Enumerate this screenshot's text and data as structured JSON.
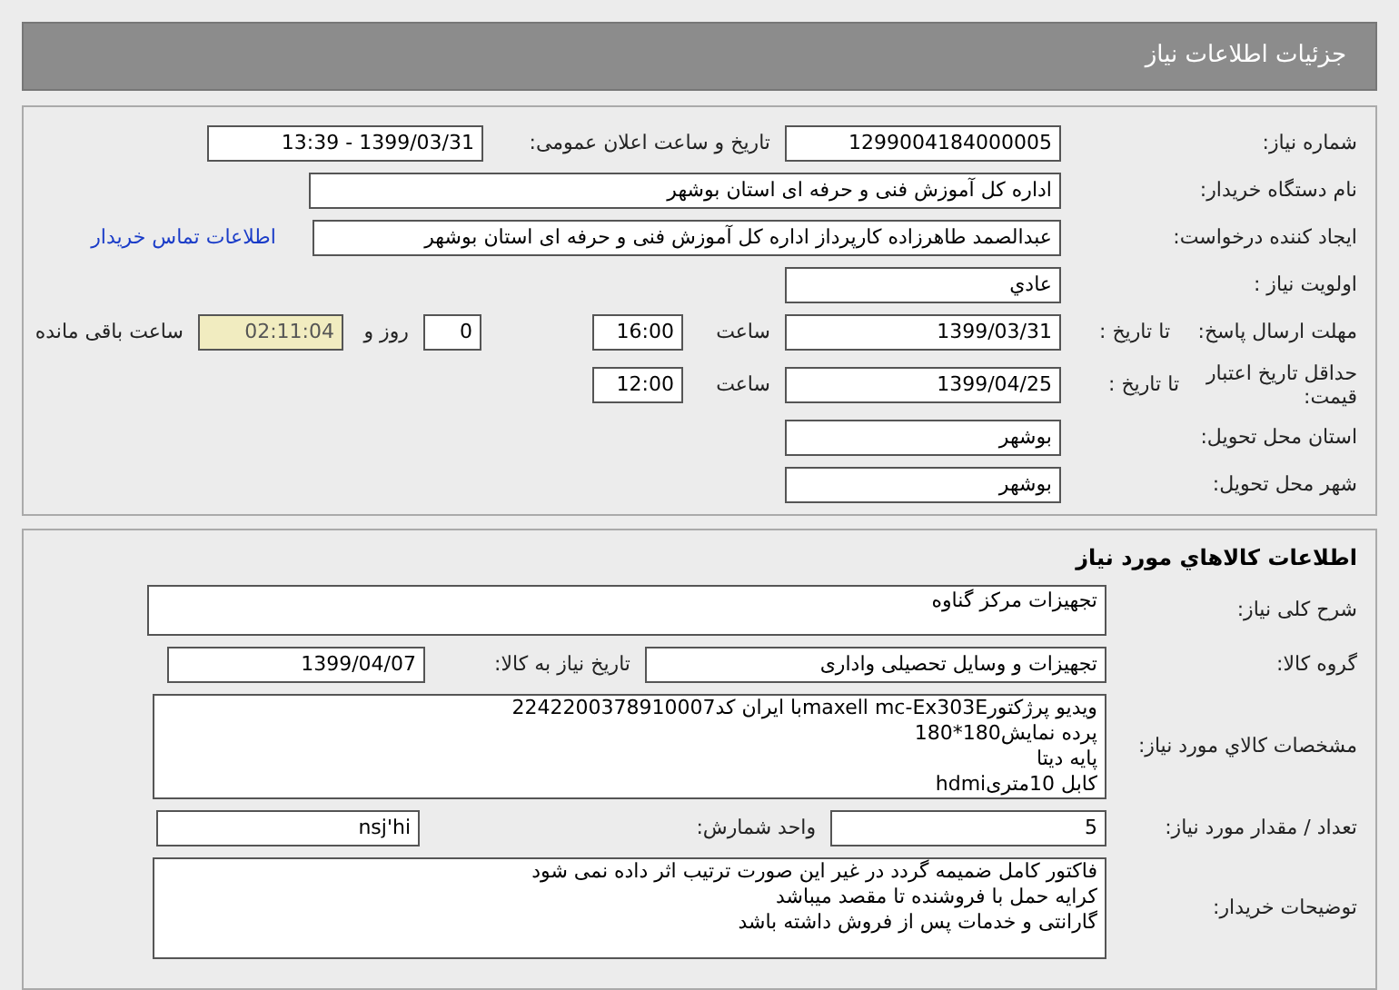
{
  "header": {
    "title": "جزئیات اطلاعات نیاز"
  },
  "need": {
    "number_label": "شماره نیاز:",
    "number": "1299004184000005",
    "announce_label": "تاریخ و ساعت اعلان عمومی:",
    "announce": "1399/03/31 - 13:39",
    "buyer_label": "نام دستگاه خریدار:",
    "buyer": "اداره کل آموزش فنی و حرفه ای استان بوشهر",
    "creator_label": "ایجاد کننده درخواست:",
    "creator": "عبدالصمد طاهرزاده کارپرداز اداره کل آموزش فنی و حرفه ای استان بوشهر",
    "contact_link": "اطلاعات تماس خریدار",
    "priority_label": "اولویت نیاز :",
    "priority": "عادي",
    "deadline_label": "مهلت ارسال پاسخ:",
    "deadline_to": "تا تاریخ :",
    "deadline_date": "1399/03/31",
    "deadline_hour_label": "ساعت",
    "deadline_hour": "16:00",
    "days": "0",
    "days_label": "روز و",
    "remaining": "02:11:04",
    "remaining_label": "ساعت باقی مانده",
    "validity_label": "حداقل تاریخ اعتبار قیمت:",
    "validity_to": "تا تاریخ :",
    "validity_date": "1399/04/25",
    "validity_hour_label": "ساعت",
    "validity_hour": "12:00",
    "province_label": "استان محل تحویل:",
    "province": "بوشهر",
    "city_label": "شهر محل تحویل:",
    "city": "بوشهر"
  },
  "goods": {
    "title": "اطلاعات کالاهاي مورد نیاز",
    "summary_label": "شرح کلی نیاز:",
    "summary": "تجهیزات مرکز گناوه",
    "group_label": "گروه کالا:",
    "group": "تجهیزات و وسایل تحصیلی واداری",
    "need_date_label": "تاریخ نیاز به کالا:",
    "need_date": "1399/04/07",
    "specs_label": "مشخصات کالاي مورد نیاز:",
    "specs": [
      "ویدیو پرژکتورmaxell mc-Ex303Eبا ایران کد2242200378910007",
      "پرده نمایش180*180",
      "پایه دیتا",
      "کابل 10متریhdmi"
    ],
    "quantity_label": "تعداد / مقدار مورد نیاز:",
    "quantity": "5",
    "unit_label": "واحد شمارش:",
    "unit": "nsj'hi",
    "notes_label": "توضیحات خریدار:",
    "notes": [
      "فاکتور کامل ضمیمه گردد در غیر این صورت ترتیب اثر داده نمی شود",
      "کرایه حمل با فروشنده تا مقصد میباشد",
      "گارانتی و خدمات پس از فروش داشته باشد"
    ]
  }
}
